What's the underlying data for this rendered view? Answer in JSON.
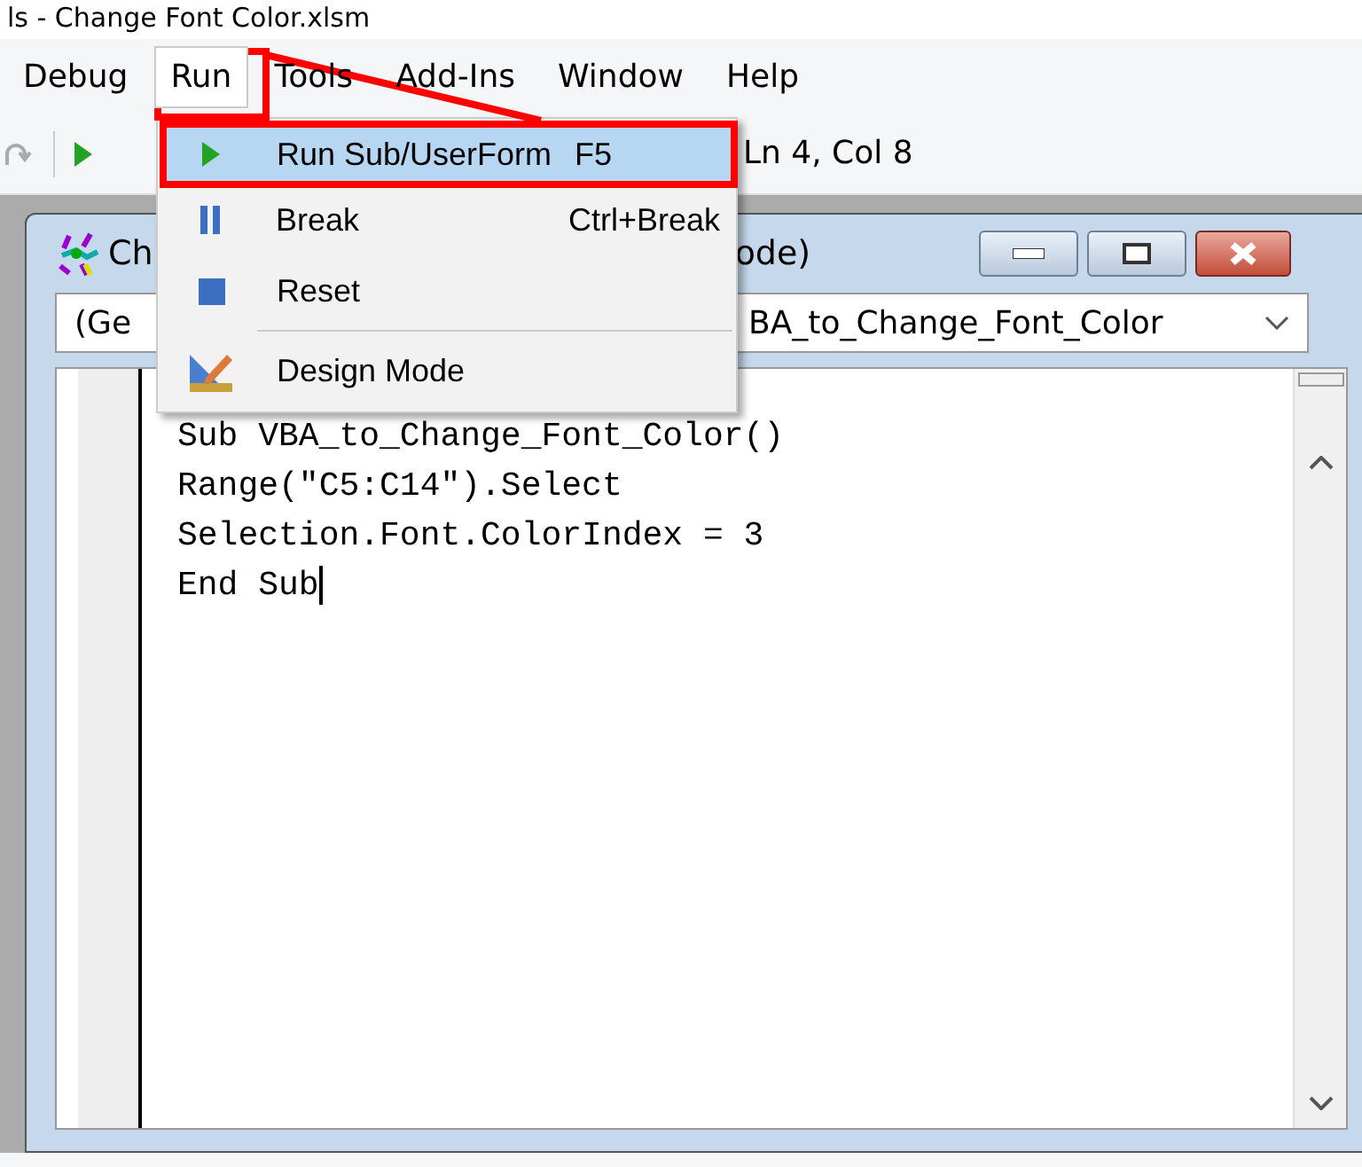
{
  "title": "ls - Change Font Color.xlsm",
  "menu_bar": [
    {
      "label": "Debug",
      "selected": false
    },
    {
      "label": "Run",
      "selected": true
    },
    {
      "label": "Tools",
      "selected": false
    },
    {
      "label": "Add-Ins",
      "selected": false
    },
    {
      "label": "Window",
      "selected": false
    },
    {
      "label": "Help",
      "selected": false
    }
  ],
  "toolbar": {
    "position": "Ln 4, Col 8"
  },
  "run_menu": [
    {
      "kind": "run",
      "label": "Run Sub/UserForm",
      "shortcut": "F5",
      "selected": true,
      "separator_before": false
    },
    {
      "kind": "break",
      "label": "Break",
      "shortcut": "Ctrl+Break",
      "selected": false,
      "separator_before": false
    },
    {
      "kind": "reset",
      "label": "Reset",
      "selected": false,
      "separator_before": false
    },
    {
      "kind": "design",
      "label": "Design Mode",
      "selected": false,
      "separator_before": true
    }
  ],
  "code_window": {
    "title_start": "Ch",
    "title_end": "ode)",
    "object_combo": "(Ge",
    "procedure_combo": "BA_to_Change_Font_Color",
    "lines": [
      "Sub VBA_to_Change_Font_Color()",
      "Range(\"C5:C14\").Select",
      "Selection.Font.ColorIndex = 3",
      "End Sub"
    ]
  }
}
